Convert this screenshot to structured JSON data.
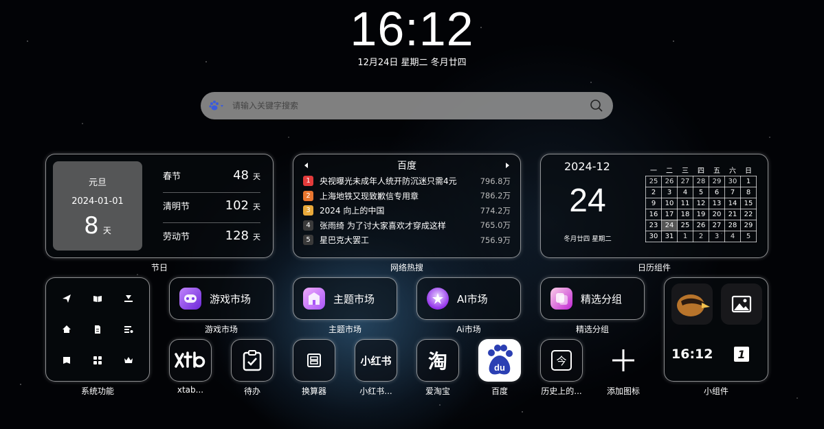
{
  "clock": {
    "time": "16:12",
    "date": "12月24日 星期二 冬月廿四"
  },
  "search": {
    "placeholder": "请输入关键字搜索",
    "engine_icon": "baidu-paw-icon",
    "search_icon": "magnifier-icon"
  },
  "holidays": {
    "main": {
      "name": "元旦",
      "date": "2024-01-01",
      "count": "8",
      "unit": "天"
    },
    "list": [
      {
        "name": "春节",
        "count": "48",
        "unit": "天"
      },
      {
        "name": "清明节",
        "count": "102",
        "unit": "天"
      },
      {
        "name": "劳动节",
        "count": "128",
        "unit": "天"
      }
    ],
    "caption": "节日"
  },
  "hot": {
    "title": "百度",
    "caption": "网络热搜",
    "items": [
      {
        "rank": "1",
        "title": "央视曝光未成年人统开防沉迷只需4元",
        "heat": "796.8万",
        "color": "#e23b3b"
      },
      {
        "rank": "2",
        "title": "上海地铁又现致歉信专用章",
        "heat": "786.2万",
        "color": "#e8762f"
      },
      {
        "rank": "3",
        "title": "2024 向上的中国",
        "heat": "774.2万",
        "color": "#e9a93a"
      },
      {
        "rank": "4",
        "title": "张雨绮 为了讨大家喜欢才穿成这样",
        "heat": "765.0万",
        "color": "#3a3a3a"
      },
      {
        "rank": "5",
        "title": "星巴克大罢工",
        "heat": "756.9万",
        "color": "#3a3a3a"
      }
    ]
  },
  "calendar": {
    "year_month": "2024-12",
    "day": "24",
    "sub": "冬月廿四 星期二",
    "caption": "日历组件",
    "weekdays": [
      "一",
      "二",
      "三",
      "四",
      "五",
      "六",
      "日"
    ],
    "weeks": [
      [
        "25",
        "26",
        "27",
        "28",
        "29",
        "30",
        "1"
      ],
      [
        "2",
        "3",
        "4",
        "5",
        "6",
        "7",
        "8"
      ],
      [
        "9",
        "10",
        "11",
        "12",
        "13",
        "14",
        "15"
      ],
      [
        "16",
        "17",
        "18",
        "19",
        "20",
        "21",
        "22"
      ],
      [
        "23",
        "24",
        "25",
        "26",
        "27",
        "28",
        "29"
      ],
      [
        "30",
        "31",
        "1",
        "2",
        "3",
        "4",
        "5"
      ]
    ]
  },
  "system": {
    "caption": "系统功能",
    "icons": [
      "paper-plane-icon",
      "book-icon",
      "download-icon",
      "home-icon",
      "document-icon",
      "list-icon",
      "bookmark-icon",
      "grid-icon",
      "crown-icon"
    ]
  },
  "pills": [
    {
      "label": "游戏市场",
      "caption": "游戏市场",
      "icon": "game-market-icon"
    },
    {
      "label": "主题市场",
      "caption": "主题市场",
      "icon": "theme-market-icon"
    },
    {
      "label": "AI市场",
      "caption": "Ai市场",
      "icon": "ai-market-icon"
    },
    {
      "label": "精选分组",
      "caption": "精选分组",
      "icon": "featured-group-icon"
    }
  ],
  "apps": [
    {
      "label": "xtab...",
      "icon": "xtab-logo-icon"
    },
    {
      "label": "待办",
      "icon": "todo-clipboard-icon"
    },
    {
      "label": "换算器",
      "icon": "converter-icon"
    },
    {
      "label": "小红书...",
      "icon": "xiaohongshu-logo-icon",
      "logo_text": "小红书"
    },
    {
      "label": "爱淘宝",
      "icon": "taobao-logo-icon",
      "logo_text": "淘"
    },
    {
      "label": "百度",
      "icon": "baidu-logo-icon",
      "logo_text": "du"
    },
    {
      "label": "历史上的...",
      "icon": "history-today-icon",
      "logo_text": "今"
    },
    {
      "label": "添加图标",
      "icon": "add-icon"
    }
  ],
  "widgets": {
    "caption": "小组件",
    "clock": "16:12",
    "calendar_day": "1",
    "icons": [
      "bird-avatar-icon",
      "image-icon"
    ]
  },
  "colors": {
    "accent": "#8b5cf6",
    "search_bg": "#969696",
    "hot_rank1": "#e23b3b"
  }
}
